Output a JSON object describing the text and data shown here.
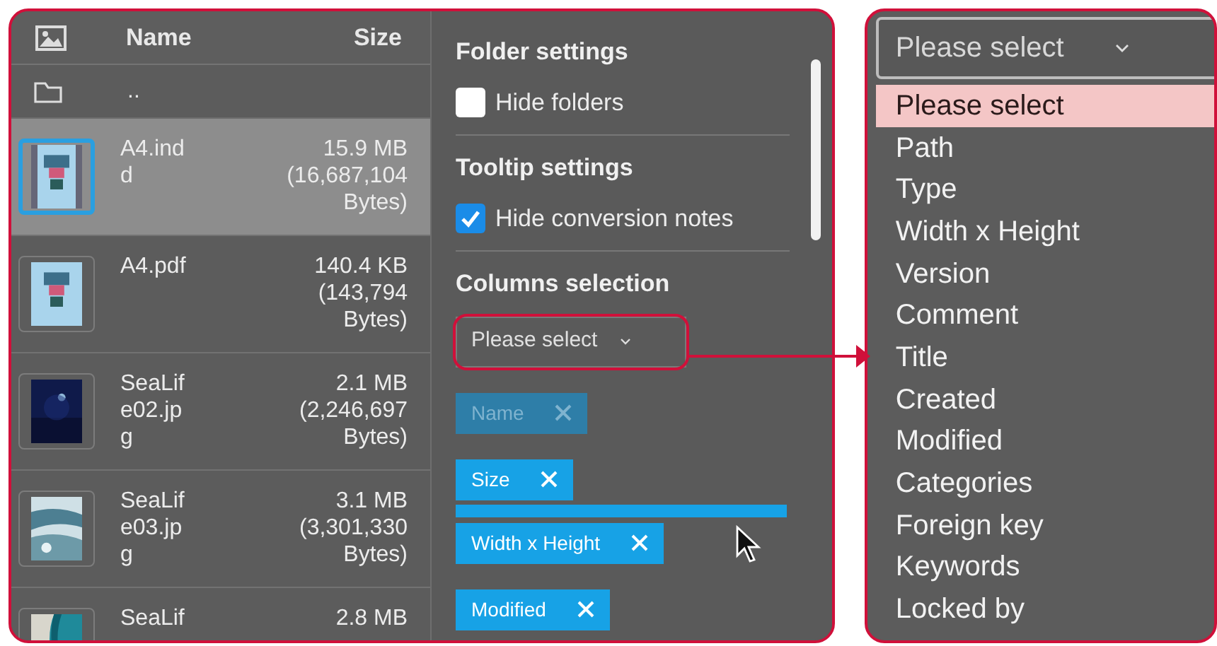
{
  "file_list": {
    "columns": [
      "Name",
      "Size"
    ],
    "rows": [
      {
        "kind": "parent",
        "name": "..",
        "selected": false
      },
      {
        "kind": "file",
        "name": "A4.indd",
        "size": "15.9 MB",
        "bytes": "(16,687,104 Bytes)",
        "selected": true
      },
      {
        "kind": "file",
        "name": "A4.pdf",
        "size": "140.4 KB",
        "bytes": "(143,794 Bytes)",
        "selected": false
      },
      {
        "kind": "file",
        "name": "SeaLife02.jpg",
        "size": "2.1 MB",
        "bytes": "(2,246,697 Bytes)",
        "selected": false
      },
      {
        "kind": "file",
        "name": "SeaLife03.jpg",
        "size": "3.1 MB",
        "bytes": "(3,301,330 Bytes)",
        "selected": false
      },
      {
        "kind": "file",
        "name": "SeaLif",
        "size": "2.8 MB",
        "selected": false
      }
    ]
  },
  "settings": {
    "sections": [
      {
        "title": "Folder settings",
        "checkbox": {
          "label": "Hide folders",
          "checked": false
        }
      },
      {
        "title": "Tooltip settings",
        "checkbox": {
          "label": "Hide conversion notes",
          "checked": true
        }
      },
      {
        "title": "Columns selection",
        "select": {
          "value": "Please select"
        },
        "tags": [
          {
            "label": "Name",
            "disabled": true
          },
          {
            "label": "Size",
            "disabled": false
          },
          {
            "label": "Width x Height",
            "disabled": false
          },
          {
            "label": "Modified",
            "disabled": false
          }
        ]
      }
    ]
  },
  "dropdown": {
    "value": "Please select",
    "options": [
      {
        "label": "Please select",
        "selected": true
      },
      {
        "label": "Path",
        "selected": false
      },
      {
        "label": "Type",
        "selected": false
      },
      {
        "label": "Width x Height",
        "selected": false
      },
      {
        "label": "Version",
        "selected": false
      },
      {
        "label": "Comment",
        "selected": false
      },
      {
        "label": "Title",
        "selected": false
      },
      {
        "label": "Created",
        "selected": false
      },
      {
        "label": "Modified",
        "selected": false
      },
      {
        "label": "Categories",
        "selected": false
      },
      {
        "label": "Foreign key",
        "selected": false
      },
      {
        "label": "Keywords",
        "selected": false
      },
      {
        "label": "Locked by",
        "selected": false
      }
    ]
  }
}
